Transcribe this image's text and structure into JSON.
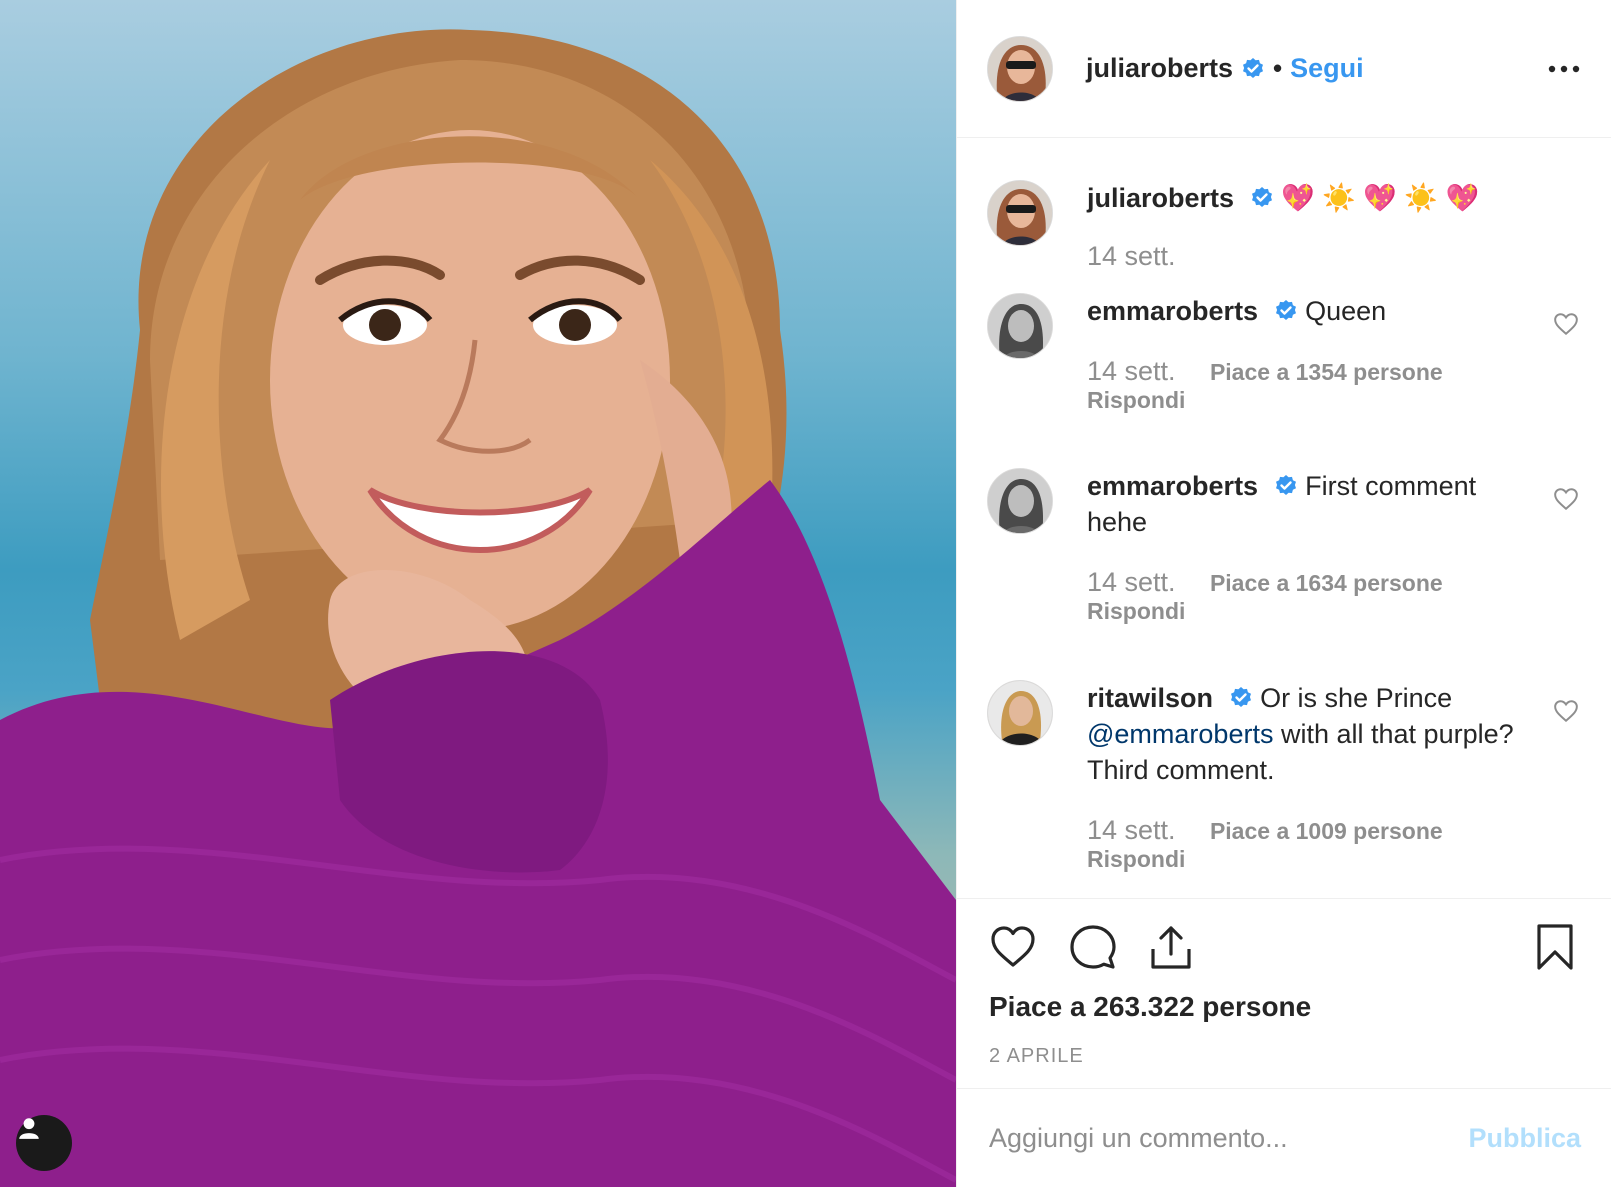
{
  "header": {
    "username": "juliaroberts",
    "separator": "•",
    "follow_label": "Segui"
  },
  "caption": {
    "username": "juliaroberts",
    "text": "💖 ☀️ 💖 ☀️ 💖",
    "time": "14 sett."
  },
  "comments": [
    {
      "username": "emmaroberts",
      "text": "Queen",
      "time": "14 sett.",
      "likes": "Piace a 1354 persone",
      "reply": "Rispondi"
    },
    {
      "username": "emmaroberts",
      "text": "First comment hehe",
      "time": "14 sett.",
      "likes": "Piace a 1634 persone",
      "reply": "Rispondi"
    },
    {
      "username": "ritawilson",
      "text_before": "Or is she Prince",
      "mention": "@emmaroberts",
      "text_after": "with all that purple? Third comment.",
      "time": "14 sett.",
      "likes": "Piace a 1009 persone",
      "reply": "Rispondi"
    }
  ],
  "post": {
    "likes_total": "Piace a 263.322 persone",
    "date": "2 APRILE"
  },
  "composer": {
    "placeholder": "Aggiungi un commento...",
    "publish_label": "Pubblica"
  },
  "icons": {
    "verified": "verified-badge-icon",
    "more": "more-options-icon",
    "like": "heart-icon",
    "comment": "comment-icon",
    "share": "share-icon",
    "save": "bookmark-icon",
    "tagged_user": "user-icon"
  },
  "colors": {
    "accent": "#3897f0",
    "verified": "#3897f0",
    "mention": "#00376b",
    "muted": "#8e8e8e",
    "publish_disabled": "#b2dffc",
    "sweater": "#8e1f8c"
  }
}
